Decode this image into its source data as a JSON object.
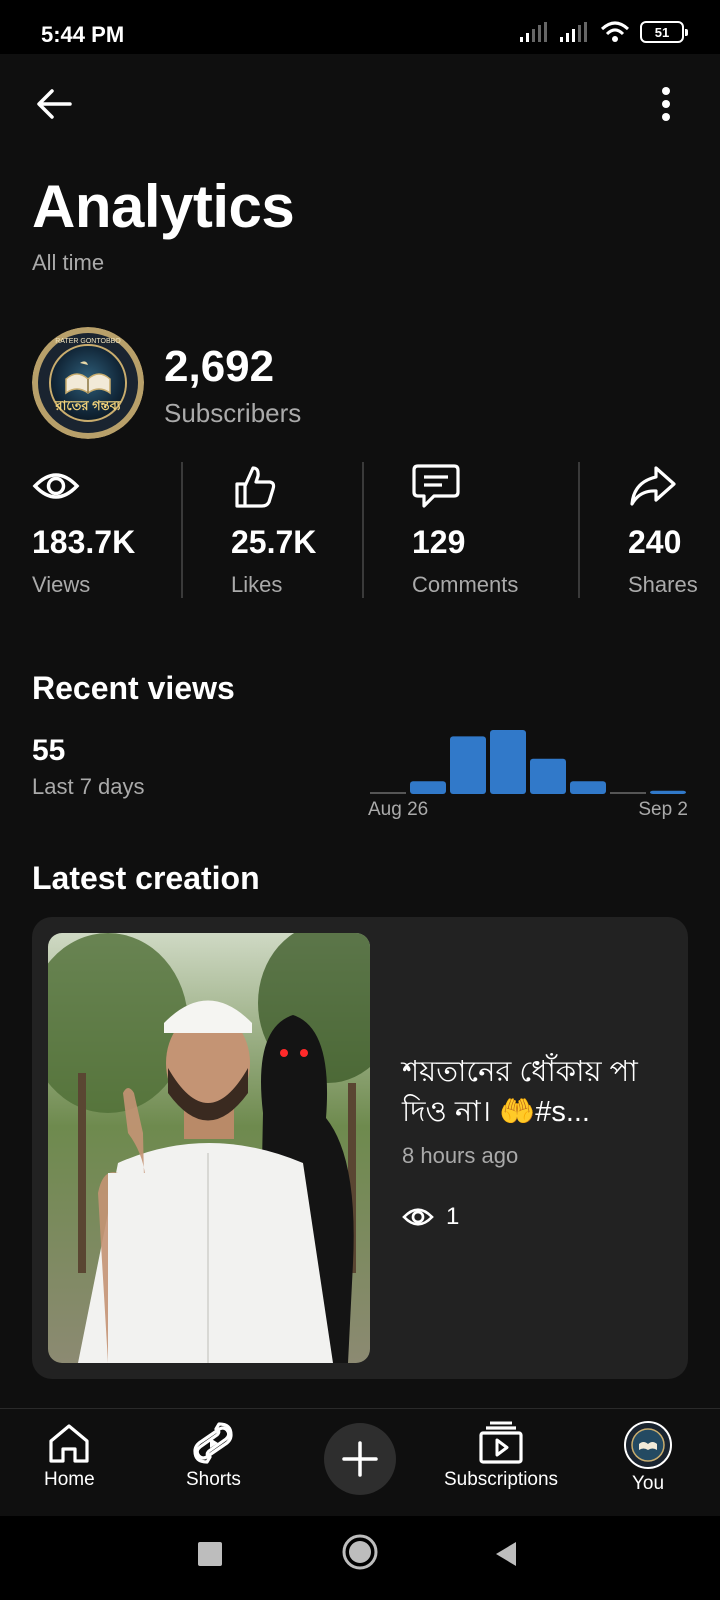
{
  "status_bar": {
    "time": "5:44 PM",
    "battery": "51",
    "icons": [
      "signal-icon",
      "signal-icon",
      "wifi-icon",
      "battery-icon"
    ]
  },
  "header": {
    "back_icon": "arrow-back-icon",
    "more_icon": "more-vert-icon",
    "title": "Analytics",
    "subtitle": "All time"
  },
  "channel": {
    "avatar_text": "রাতের গন্তব্য",
    "avatar_ring_text": "RATER GONTOBBO",
    "subscribers_value": "2,692",
    "subscribers_label": "Subscribers"
  },
  "stats": [
    {
      "icon": "eye-icon",
      "value": "183.7K",
      "label": "Views"
    },
    {
      "icon": "thumbs-up-icon",
      "value": "25.7K",
      "label": "Likes"
    },
    {
      "icon": "comment-icon",
      "value": "129",
      "label": "Comments"
    },
    {
      "icon": "share-icon",
      "value": "240",
      "label": "Shares"
    }
  ],
  "recent_views": {
    "title": "Recent views",
    "value": "55",
    "label": "Last 7 days"
  },
  "chart_data": {
    "type": "bar",
    "title": "",
    "xlabel": "",
    "ylabel": "",
    "tick_labels": [
      "Aug 26",
      "Sep 2"
    ],
    "values": [
      0,
      4,
      18,
      20,
      11,
      4,
      0,
      1
    ],
    "ylim": [
      0,
      20
    ],
    "grid": false,
    "colors": {
      "bar": "#3179c9",
      "zero": "#555555"
    }
  },
  "latest_creation": {
    "title": "Latest creation",
    "video_title": "শয়তানের ধোঁকায় পা দিও না। 🤲#s...",
    "time_ago": "8 hours ago",
    "views": "1"
  },
  "bottom_nav": {
    "items": [
      {
        "icon": "home-icon",
        "label": "Home"
      },
      {
        "icon": "shorts-icon",
        "label": "Shorts"
      },
      {
        "icon": "plus-icon",
        "label": ""
      },
      {
        "icon": "subscriptions-icon",
        "label": "Subscriptions"
      },
      {
        "icon": "avatar",
        "label": "You"
      }
    ]
  },
  "system_nav": [
    "square-icon",
    "circle-icon",
    "triangle-back-icon"
  ]
}
